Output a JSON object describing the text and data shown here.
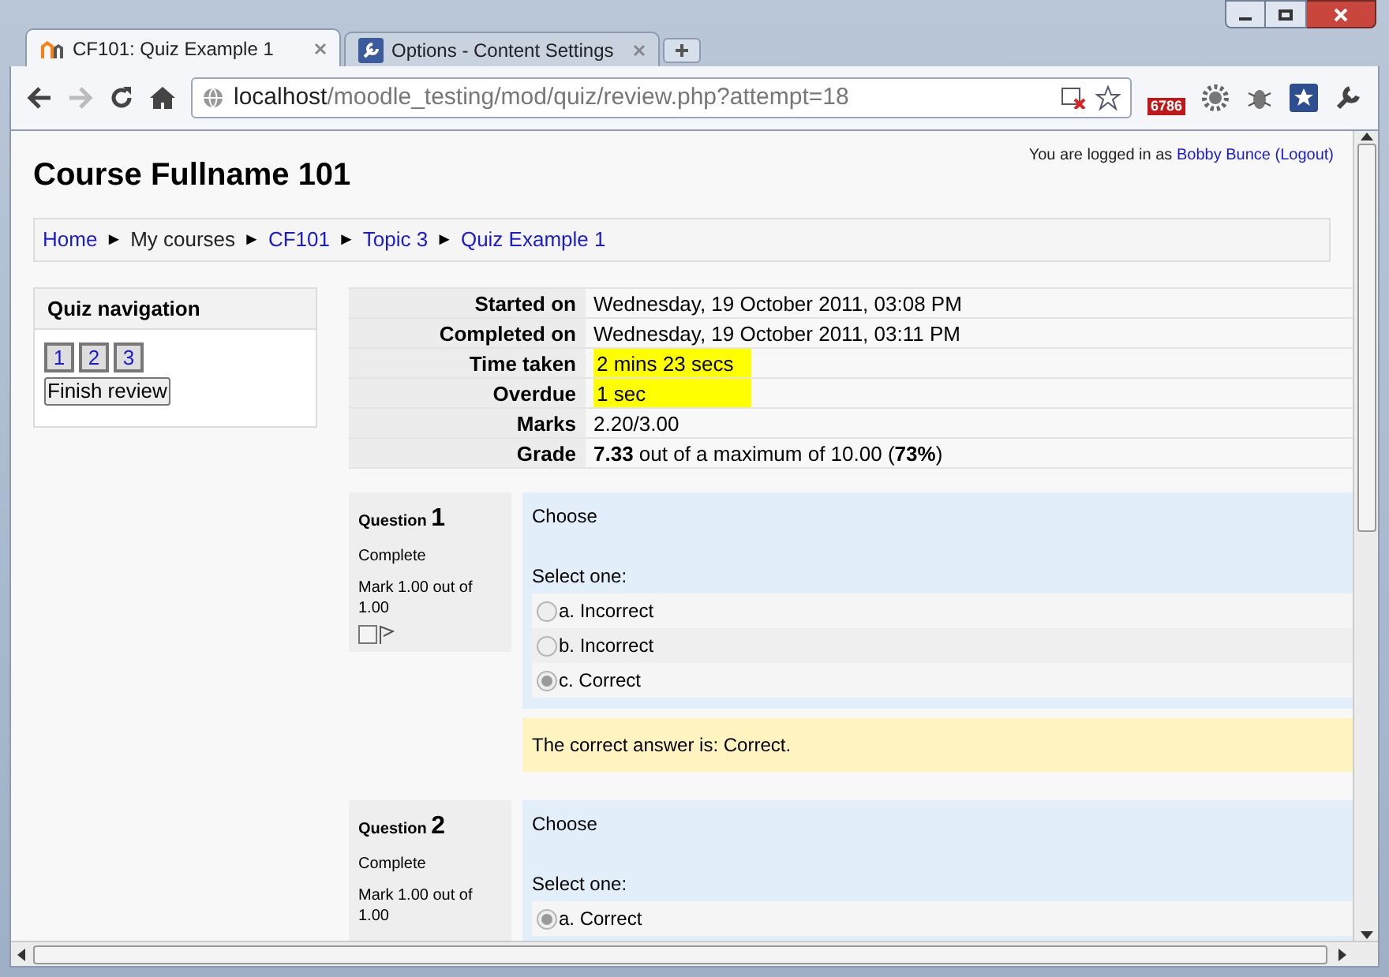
{
  "browser": {
    "tabs": [
      {
        "label": "CF101: Quiz Example 1",
        "selected": true,
        "kind": "moodle"
      },
      {
        "label": "Options - Content Settings",
        "selected": false,
        "kind": "wrench"
      }
    ],
    "url_host": "localhost",
    "url_path": "/moodle_testing/mod/quiz/review.php?attempt=18",
    "extension_badge": "6786"
  },
  "page": {
    "title": "Course Fullname 101",
    "login_prefix": "You are logged in as",
    "login_user": "Bobby Bunce",
    "login_logout": "(Logout)",
    "breadcrumb": [
      {
        "label": "Home",
        "link": true
      },
      {
        "label": "My courses",
        "link": false
      },
      {
        "label": "CF101",
        "link": true
      },
      {
        "label": "Topic 3",
        "link": true
      },
      {
        "label": "Quiz Example 1",
        "link": true
      }
    ],
    "breadcrumb_separator": "►",
    "quiz_navigation": {
      "title": "Quiz navigation",
      "pages": [
        "1",
        "2",
        "3"
      ],
      "finish_button": "Finish review"
    },
    "summary": [
      {
        "label": "Started on",
        "value": "Wednesday, 19 October 2011, 03:08 PM",
        "highlighted": false
      },
      {
        "label": "Completed on",
        "value": "Wednesday, 19 October 2011, 03:11 PM",
        "highlighted": false
      },
      {
        "label": "Time taken",
        "value": "2 mins 23 secs",
        "highlighted": true
      },
      {
        "label": "Overdue",
        "value": "1 sec",
        "highlighted": true
      },
      {
        "label": "Marks",
        "value": "2.20/3.00",
        "highlighted": false
      },
      {
        "label": "Grade",
        "value": "**7.33** out of a maximum of 10.00 (**73%**)",
        "highlighted": false
      }
    ],
    "questions": [
      {
        "label": "Question",
        "number": "1",
        "state": "Complete",
        "mark": "Mark 1.00 out of 1.00",
        "checked": false,
        "text": "Choose",
        "prompt": "Select one:",
        "options": [
          {
            "label": "a. Incorrect",
            "selected": false
          },
          {
            "label": "b. Incorrect",
            "selected": false
          },
          {
            "label": "c. Correct",
            "selected": true
          }
        ],
        "feedback": "The correct answer is: Correct."
      },
      {
        "label": "Question",
        "number": "2",
        "state": "Complete",
        "mark": "Mark 1.00 out of 1.00",
        "text": "Choose",
        "prompt": "Select one:",
        "options": [
          {
            "label": "a. Correct",
            "selected": true
          }
        ]
      }
    ]
  }
}
